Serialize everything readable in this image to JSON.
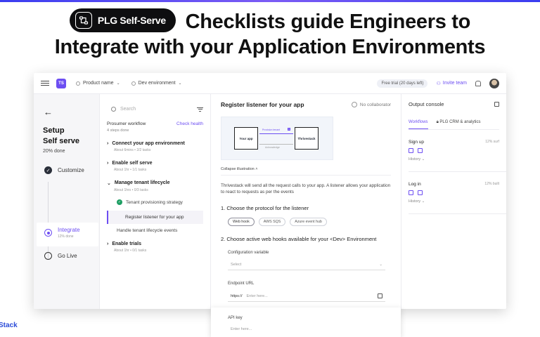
{
  "hero": {
    "badge": "PLG Self-Serve",
    "line1": "Checklists guide Engineers to",
    "line2": "Integrate with your Application Environments"
  },
  "edge_brand": "Stack",
  "header": {
    "logo": "TS",
    "product": "Product name",
    "environment": "Dev environment",
    "trial": "Free trial (20 days left)",
    "invite": "Invite team"
  },
  "rail": {
    "title_line1": "Setup",
    "title_line2": "Self serve",
    "percent": "20% done",
    "steps": [
      {
        "label": "Customize",
        "sub": ""
      },
      {
        "label": "Integrate",
        "sub": "12% done"
      },
      {
        "label": "Go Live",
        "sub": ""
      }
    ]
  },
  "workflow": {
    "search_placeholder": "Search",
    "heading": "Prosumer workflow",
    "check_health": "Check health",
    "steps_done": "4 steps done",
    "groups": [
      {
        "title": "Connect your app environment",
        "meta": "About 6mins  •  2/2 tasks"
      },
      {
        "title": "Enable self serve",
        "meta": "About 1hr  •  1/1 tasks"
      },
      {
        "title": "Manage tenant lifecycle",
        "meta": "About 1hrs  •  0/3 tasks"
      },
      {
        "title": "Enable trials",
        "meta": "About 1hr  •  0/1 tasks"
      }
    ],
    "tasks": [
      "Tenant provisioning strategy",
      "Register listener for your app",
      "Handle tenant lifecycle events"
    ]
  },
  "main": {
    "title": "Register listener for your app",
    "collaborator": "No collaborator",
    "illustration": {
      "left_box": "Your app",
      "right_box": "Thrivestack",
      "arrow_top": "Provision tenant",
      "arrow_top_badge": "1",
      "arrow_bottom": "Acknowledge"
    },
    "collapse_label": "Collapse illustration",
    "description": "Thrivestack will send all the request calls to your app. A listener allows your application to react to requests as per the events",
    "q1": "1.  Choose the protocol for the listener",
    "protocols": [
      "Web hook",
      "AWS SQS",
      "Azure event hub"
    ],
    "q2": "2.  Choose active web hooks available for your <Dev> Environment",
    "config_label": "Configuration variable",
    "config_placeholder": "Select",
    "endpoint_label": "Endpoint URL",
    "endpoint_proto": "https://",
    "endpoint_placeholder": "Enter here...",
    "apikey_label": "API key",
    "apikey_placeholder": "Enter here..."
  },
  "console": {
    "title": "Output console",
    "tabs": [
      "Workflows",
      "PLG CRM & analytics"
    ],
    "events": [
      {
        "name": "Sign up",
        "meta": "12% surf",
        "history": "History"
      },
      {
        "name": "Log in",
        "meta": "12% built",
        "history": "History"
      }
    ]
  }
}
